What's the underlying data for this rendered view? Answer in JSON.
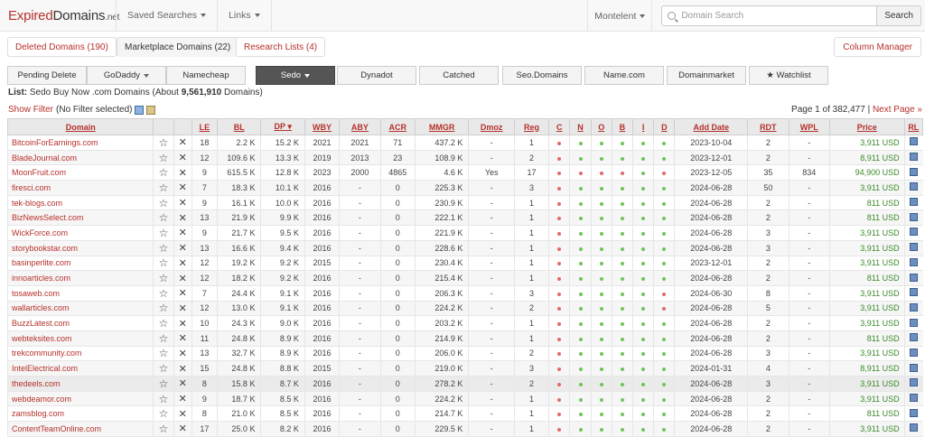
{
  "logo": {
    "part1": "Expired",
    "part2": "Domains",
    "part3": ".net"
  },
  "nav": {
    "saved_searches": "Saved Searches",
    "links": "Links",
    "user": "Montelent",
    "search_placeholder": "Domain Search",
    "search_button": "Search"
  },
  "tabs": [
    {
      "label": "Deleted Domains (190)"
    },
    {
      "label": "Marketplace Domains (22)"
    },
    {
      "label": "Research Lists (4)"
    }
  ],
  "column_manager": "Column Manager",
  "filters": [
    {
      "label": "Pending Delete"
    },
    {
      "label": "GoDaddy"
    },
    {
      "label": "Namecheap"
    },
    {
      "label": "Sedo"
    },
    {
      "label": "Dynadot"
    },
    {
      "label": "Catched"
    },
    {
      "label": "Seo.Domains"
    },
    {
      "label": "Name.com"
    },
    {
      "label": "Domainmarket"
    },
    {
      "label": "★ Watchlist"
    }
  ],
  "list": {
    "label": "List:",
    "text1": "Sedo Buy Now .com Domains (About ",
    "count": "9,561,910",
    "text2": " Domains)"
  },
  "filter_line": {
    "show_filter": "Show Filter",
    "status": "(No Filter selected)"
  },
  "pagination": {
    "page_text": "Page 1 of 382,477 |",
    "next": "Next Page »"
  },
  "table": {
    "headers": [
      "Domain",
      "",
      "",
      "LE",
      "BL",
      "DP",
      "WBY",
      "ABY",
      "ACR",
      "MMGR",
      "Dmoz",
      "Reg",
      "C",
      "N",
      "O",
      "B",
      "I",
      "D",
      "Add Date",
      "RDT",
      "WPL",
      "Price",
      "RL"
    ],
    "rows": [
      {
        "domain": "BitcoinForEarnings.com",
        "le": "18",
        "bl": "2.2 K",
        "dp": "15.2 K",
        "wby": "2021",
        "aby": "2021",
        "acr": "71",
        "mmgr": "437.2 K",
        "dmoz": "-",
        "reg": "1",
        "dots": [
          "r",
          "g",
          "g",
          "g",
          "g",
          "g"
        ],
        "add": "2023-10-04",
        "rdt": "2",
        "wpl": "-",
        "price": "3,911 USD"
      },
      {
        "domain": "BladeJournal.com",
        "le": "12",
        "bl": "109.6 K",
        "dp": "13.3 K",
        "wby": "2019",
        "aby": "2013",
        "acr": "23",
        "mmgr": "108.9 K",
        "dmoz": "-",
        "reg": "2",
        "dots": [
          "r",
          "g",
          "g",
          "g",
          "g",
          "g"
        ],
        "add": "2023-12-01",
        "rdt": "2",
        "wpl": "-",
        "price": "8,911 USD"
      },
      {
        "domain": "MoonFruit.com",
        "le": "9",
        "bl": "615.5 K",
        "dp": "12.8 K",
        "wby": "2023",
        "aby": "2000",
        "acr": "4865",
        "mmgr": "4.6 K",
        "dmoz": "Yes",
        "reg": "17",
        "dots": [
          "r",
          "r",
          "r",
          "r",
          "g",
          "r"
        ],
        "add": "2023-12-05",
        "rdt": "35",
        "wpl": "834",
        "price": "94,900 USD"
      },
      {
        "domain": "firesci.com",
        "le": "7",
        "bl": "18.3 K",
        "dp": "10.1 K",
        "wby": "2016",
        "aby": "-",
        "acr": "0",
        "mmgr": "225.3 K",
        "dmoz": "-",
        "reg": "3",
        "dots": [
          "r",
          "g",
          "g",
          "g",
          "g",
          "g"
        ],
        "add": "2024-06-28",
        "rdt": "50",
        "wpl": "-",
        "price": "3,911 USD"
      },
      {
        "domain": "tek-blogs.com",
        "le": "9",
        "bl": "16.1 K",
        "dp": "10.0 K",
        "wby": "2016",
        "aby": "-",
        "acr": "0",
        "mmgr": "230.9 K",
        "dmoz": "-",
        "reg": "1",
        "dots": [
          "r",
          "g",
          "g",
          "g",
          "g",
          "g"
        ],
        "add": "2024-06-28",
        "rdt": "2",
        "wpl": "-",
        "price": "811 USD"
      },
      {
        "domain": "BizNewsSelect.com",
        "le": "13",
        "bl": "21.9 K",
        "dp": "9.9 K",
        "wby": "2016",
        "aby": "-",
        "acr": "0",
        "mmgr": "222.1 K",
        "dmoz": "-",
        "reg": "1",
        "dots": [
          "r",
          "g",
          "g",
          "g",
          "g",
          "g"
        ],
        "add": "2024-06-28",
        "rdt": "2",
        "wpl": "-",
        "price": "811 USD"
      },
      {
        "domain": "WickForce.com",
        "le": "9",
        "bl": "21.7 K",
        "dp": "9.5 K",
        "wby": "2016",
        "aby": "-",
        "acr": "0",
        "mmgr": "221.9 K",
        "dmoz": "-",
        "reg": "1",
        "dots": [
          "r",
          "g",
          "g",
          "g",
          "g",
          "g"
        ],
        "add": "2024-06-28",
        "rdt": "3",
        "wpl": "-",
        "price": "3,911 USD"
      },
      {
        "domain": "storybookstar.com",
        "le": "13",
        "bl": "16.6 K",
        "dp": "9.4 K",
        "wby": "2016",
        "aby": "-",
        "acr": "0",
        "mmgr": "228.6 K",
        "dmoz": "-",
        "reg": "1",
        "dots": [
          "r",
          "g",
          "g",
          "g",
          "g",
          "g"
        ],
        "add": "2024-06-28",
        "rdt": "3",
        "wpl": "-",
        "price": "3,911 USD"
      },
      {
        "domain": "basinperlite.com",
        "le": "12",
        "bl": "19.2 K",
        "dp": "9.2 K",
        "wby": "2015",
        "aby": "-",
        "acr": "0",
        "mmgr": "230.4 K",
        "dmoz": "-",
        "reg": "1",
        "dots": [
          "r",
          "g",
          "g",
          "g",
          "g",
          "g"
        ],
        "add": "2023-12-01",
        "rdt": "2",
        "wpl": "-",
        "price": "3,911 USD"
      },
      {
        "domain": "innoarticles.com",
        "le": "12",
        "bl": "18.2 K",
        "dp": "9.2 K",
        "wby": "2016",
        "aby": "-",
        "acr": "0",
        "mmgr": "215.4 K",
        "dmoz": "-",
        "reg": "1",
        "dots": [
          "r",
          "g",
          "g",
          "g",
          "g",
          "g"
        ],
        "add": "2024-06-28",
        "rdt": "2",
        "wpl": "-",
        "price": "811 USD"
      },
      {
        "domain": "tosaweb.com",
        "le": "7",
        "bl": "24.4 K",
        "dp": "9.1 K",
        "wby": "2016",
        "aby": "-",
        "acr": "0",
        "mmgr": "206.3 K",
        "dmoz": "-",
        "reg": "3",
        "dots": [
          "r",
          "g",
          "g",
          "g",
          "g",
          "r"
        ],
        "add": "2024-06-30",
        "rdt": "8",
        "wpl": "-",
        "price": "3,911 USD"
      },
      {
        "domain": "wallarticles.com",
        "le": "12",
        "bl": "13.0 K",
        "dp": "9.1 K",
        "wby": "2016",
        "aby": "-",
        "acr": "0",
        "mmgr": "224.2 K",
        "dmoz": "-",
        "reg": "2",
        "dots": [
          "r",
          "g",
          "g",
          "g",
          "g",
          "r"
        ],
        "add": "2024-06-28",
        "rdt": "5",
        "wpl": "-",
        "price": "3,911 USD"
      },
      {
        "domain": "BuzzLatest.com",
        "le": "10",
        "bl": "24.3 K",
        "dp": "9.0 K",
        "wby": "2016",
        "aby": "-",
        "acr": "0",
        "mmgr": "203.2 K",
        "dmoz": "-",
        "reg": "1",
        "dots": [
          "r",
          "g",
          "g",
          "g",
          "g",
          "g"
        ],
        "add": "2024-06-28",
        "rdt": "2",
        "wpl": "-",
        "price": "3,911 USD"
      },
      {
        "domain": "webteksites.com",
        "le": "11",
        "bl": "24.8 K",
        "dp": "8.9 K",
        "wby": "2016",
        "aby": "-",
        "acr": "0",
        "mmgr": "214.9 K",
        "dmoz": "-",
        "reg": "1",
        "dots": [
          "r",
          "g",
          "g",
          "g",
          "g",
          "g"
        ],
        "add": "2024-06-28",
        "rdt": "2",
        "wpl": "-",
        "price": "811 USD"
      },
      {
        "domain": "trekcommunity.com",
        "le": "13",
        "bl": "32.7 K",
        "dp": "8.9 K",
        "wby": "2016",
        "aby": "-",
        "acr": "0",
        "mmgr": "206.0 K",
        "dmoz": "-",
        "reg": "2",
        "dots": [
          "r",
          "g",
          "g",
          "g",
          "g",
          "g"
        ],
        "add": "2024-06-28",
        "rdt": "3",
        "wpl": "-",
        "price": "3,911 USD"
      },
      {
        "domain": "IntelElectrical.com",
        "le": "15",
        "bl": "24.8 K",
        "dp": "8.8 K",
        "wby": "2015",
        "aby": "-",
        "acr": "0",
        "mmgr": "219.0 K",
        "dmoz": "-",
        "reg": "3",
        "dots": [
          "r",
          "g",
          "g",
          "g",
          "g",
          "g"
        ],
        "add": "2024-01-31",
        "rdt": "4",
        "wpl": "-",
        "price": "8,911 USD"
      },
      {
        "domain": "thedeels.com",
        "le": "8",
        "bl": "15.8 K",
        "dp": "8.7 K",
        "wby": "2016",
        "aby": "-",
        "acr": "0",
        "mmgr": "278.2 K",
        "dmoz": "-",
        "reg": "2",
        "dots": [
          "r",
          "g",
          "g",
          "g",
          "g",
          "g"
        ],
        "add": "2024-06-28",
        "rdt": "3",
        "wpl": "-",
        "price": "3,911 USD",
        "hl": true
      },
      {
        "domain": "webdeamor.com",
        "le": "9",
        "bl": "18.7 K",
        "dp": "8.5 K",
        "wby": "2016",
        "aby": "-",
        "acr": "0",
        "mmgr": "224.2 K",
        "dmoz": "-",
        "reg": "1",
        "dots": [
          "r",
          "g",
          "g",
          "g",
          "g",
          "g"
        ],
        "add": "2024-06-28",
        "rdt": "2",
        "wpl": "-",
        "price": "3,911 USD"
      },
      {
        "domain": "zamsblog.com",
        "le": "8",
        "bl": "21.0 K",
        "dp": "8.5 K",
        "wby": "2016",
        "aby": "-",
        "acr": "0",
        "mmgr": "214.7 K",
        "dmoz": "-",
        "reg": "1",
        "dots": [
          "r",
          "g",
          "g",
          "g",
          "g",
          "g"
        ],
        "add": "2024-06-28",
        "rdt": "2",
        "wpl": "-",
        "price": "811 USD"
      },
      {
        "domain": "ContentTeamOnline.com",
        "le": "17",
        "bl": "25.0 K",
        "dp": "8.2 K",
        "wby": "2016",
        "aby": "-",
        "acr": "0",
        "mmgr": "229.5 K",
        "dmoz": "-",
        "reg": "1",
        "dots": [
          "r",
          "g",
          "g",
          "g",
          "g",
          "g"
        ],
        "add": "2024-06-28",
        "rdt": "2",
        "wpl": "-",
        "price": "3,911 USD"
      }
    ]
  },
  "icons": {
    "star": "star-icon",
    "remove": "x-icon",
    "rl": "rl-icon"
  }
}
